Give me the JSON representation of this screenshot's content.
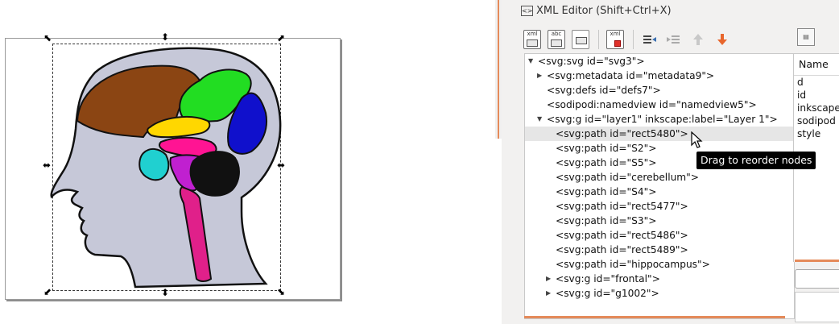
{
  "panel": {
    "title": "XML Editor (Shift+Ctrl+X)",
    "toolbar": [
      {
        "name": "new-element-node-button",
        "label": "xml"
      },
      {
        "name": "new-text-node-button",
        "label": "abc"
      },
      {
        "name": "duplicate-node-button",
        "label": ""
      },
      {
        "name": "delete-node-button",
        "label": "xml"
      },
      {
        "name": "unindent-node-button",
        "label": ""
      },
      {
        "name": "indent-node-button",
        "label": ""
      },
      {
        "name": "raise-node-button",
        "label": ""
      },
      {
        "name": "lower-node-button",
        "label": ""
      }
    ]
  },
  "tree": {
    "nodes": [
      {
        "text": "<svg:svg id=\"svg3\">",
        "level": 0,
        "toggle": "open"
      },
      {
        "text": "<svg:metadata id=\"metadata9\">",
        "level": 1,
        "toggle": "closed"
      },
      {
        "text": "<svg:defs id=\"defs7\">",
        "level": 1,
        "toggle": "none"
      },
      {
        "text": "<sodipodi:namedview id=\"namedview5\">",
        "level": 1,
        "toggle": "none"
      },
      {
        "text": "<svg:g id=\"layer1\" inkscape:label=\"Layer 1\">",
        "level": 1,
        "toggle": "open"
      },
      {
        "text": "<svg:path id=\"rect5480\">",
        "level": 2,
        "toggle": "none",
        "selected": true
      },
      {
        "text": "<svg:path id=\"S2\">",
        "level": 2,
        "toggle": "none"
      },
      {
        "text": "<svg:path id=\"S5\">",
        "level": 2,
        "toggle": "none"
      },
      {
        "text": "<svg:path id=\"cerebellum\">",
        "level": 2,
        "toggle": "none"
      },
      {
        "text": "<svg:path id=\"S4\">",
        "level": 2,
        "toggle": "none"
      },
      {
        "text": "<svg:path id=\"rect5477\">",
        "level": 2,
        "toggle": "none"
      },
      {
        "text": "<svg:path id=\"S3\">",
        "level": 2,
        "toggle": "none"
      },
      {
        "text": "<svg:path id=\"rect5486\">",
        "level": 2,
        "toggle": "none"
      },
      {
        "text": "<svg:path id=\"rect5489\">",
        "level": 2,
        "toggle": "none"
      },
      {
        "text": "<svg:path id=\"hippocampus\">",
        "level": 2,
        "toggle": "none"
      },
      {
        "text": "<svg:g id=\"frontal\">",
        "level": 2,
        "toggle": "closed"
      },
      {
        "text": "<svg:g id=\"g1002\">",
        "level": 2,
        "toggle": "closed"
      }
    ]
  },
  "attributes": {
    "header": "Name",
    "names": [
      "d",
      "id",
      "inkscape",
      "sodipod",
      "style"
    ]
  },
  "tooltip": "Drag to reorder nodes",
  "colors": {
    "accent": "#e58a5a",
    "head": "#c6c8d8",
    "frontal": "#8b4513",
    "parietal": "#22dd22",
    "occipital": "#1010cc",
    "corpus": "#ffd700",
    "thalamus": "#ff1493",
    "limbic": "#c020d0",
    "temporal": "#20d0d0",
    "cerebellum": "#111111",
    "brainstem": "#e0208a"
  }
}
